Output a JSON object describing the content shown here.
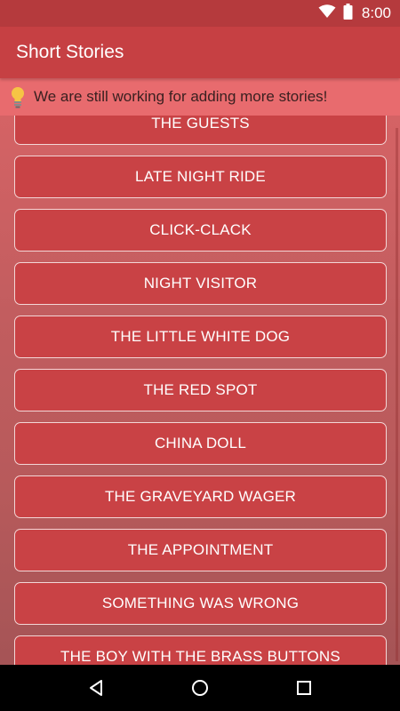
{
  "status_bar": {
    "time": "8:00",
    "icons": [
      "wifi-icon",
      "battery-icon"
    ]
  },
  "app_bar": {
    "title": "Short Stories"
  },
  "notice": {
    "icon": "lightbulb-icon",
    "text": "We are still working for adding more stories!"
  },
  "stories": [
    {
      "label": "THE GUESTS"
    },
    {
      "label": "LATE NIGHT RIDE"
    },
    {
      "label": "CLICK-CLACK"
    },
    {
      "label": "NIGHT VISITOR"
    },
    {
      "label": "THE LITTLE WHITE DOG"
    },
    {
      "label": "THE RED SPOT"
    },
    {
      "label": "CHINA DOLL"
    },
    {
      "label": "THE GRAVEYARD WAGER"
    },
    {
      "label": "THE APPOINTMENT"
    },
    {
      "label": "SOMETHING WAS WRONG"
    },
    {
      "label": "THE BOY WITH THE BRASS BUTTONS"
    }
  ],
  "nav_bar": {
    "buttons": [
      "back-icon",
      "home-icon",
      "recents-icon"
    ]
  },
  "colors": {
    "status_bar": "#b53a3d",
    "app_bar": "#c64043",
    "button_fill": "#c94245",
    "notice_bg": "#e86b6e"
  }
}
